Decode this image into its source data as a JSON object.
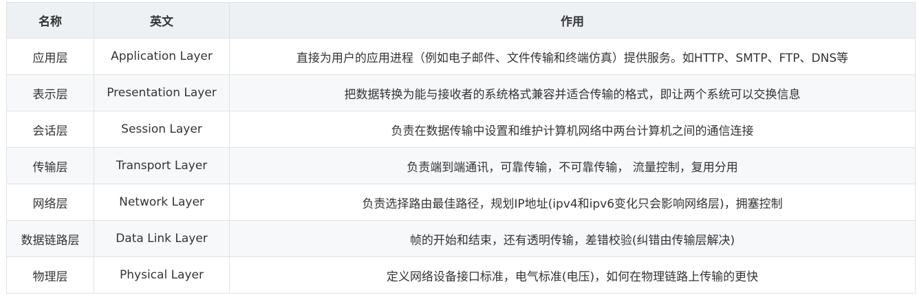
{
  "table": {
    "headers": {
      "name": "名称",
      "english": "英文",
      "function": "作用"
    },
    "rows": [
      {
        "name": "应用层",
        "english": "Application Layer",
        "function": "直接为用户的应用进程（例如电子邮件、文件传输和终端仿真）提供服务。如HTTP、SMTP、FTP、DNS等"
      },
      {
        "name": "表示层",
        "english": "Presentation Layer",
        "function": "把数据转换为能与接收者的系统格式兼容并适合传输的格式，即让两个系统可以交换信息"
      },
      {
        "name": "会话层",
        "english": "Session Layer",
        "function": "负责在数据传输中设置和维护计算机网络中两台计算机之间的通信连接"
      },
      {
        "name": "传输层",
        "english": "Transport Layer",
        "function": "负责端到端通讯，可靠传输，不可靠传输， 流量控制，复用分用"
      },
      {
        "name": "网络层",
        "english": "Network Layer",
        "function": "负责选择路由最佳路径，规划IP地址(ipv4和ipv6变化只会影响网络层)，拥塞控制"
      },
      {
        "name": "数据链路层",
        "english": "Data Link Layer",
        "function": "帧的开始和结束，还有透明传输，差错校验(纠错由传输层解决)"
      },
      {
        "name": "物理层",
        "english": "Physical Layer",
        "function": "定义网络设备接口标准，电气标准(电压)，如何在物理链路上传输的更快"
      }
    ]
  },
  "colors": {
    "header_bg": "#eef1f4",
    "stripe_bg": "#f6f8fa",
    "border": "#dfe2e5",
    "text": "#333333"
  }
}
